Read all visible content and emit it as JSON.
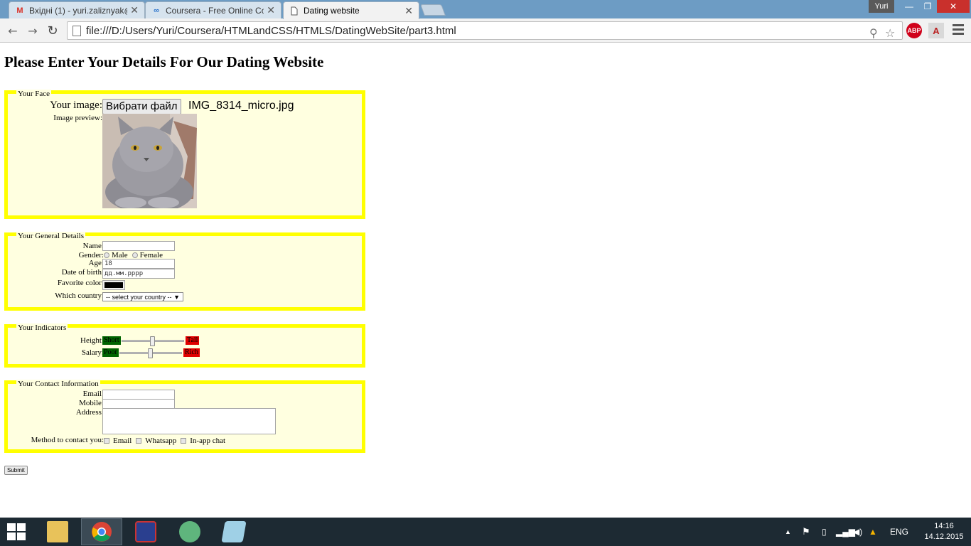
{
  "browser": {
    "tabs": [
      {
        "title": "Вхідні (1) - yuri.zaliznyak@",
        "icon": "gmail-icon"
      },
      {
        "title": "Coursera - Free Online Cou",
        "icon": "coursera-icon"
      },
      {
        "title": "Dating website",
        "icon": "page-icon"
      }
    ],
    "user": "Yuri",
    "url": "file:///D:/Users/Yuri/Coursera/HTMLandCSS/HTMLS/DatingWebSite/part3.html",
    "extensions": [
      "ABP",
      "A"
    ]
  },
  "page": {
    "title": "Please Enter Your Details For Our Dating Website",
    "face": {
      "legend": "Your Face",
      "image_label": "Your image:",
      "file_button": "Вибрати файл",
      "file_name": "IMG_8314_micro.jpg",
      "preview_label": "Image preview:"
    },
    "general": {
      "legend": "Your General Details",
      "name_label": "Name:",
      "gender_label": "Gender:",
      "male": "Male",
      "female": "Female",
      "age_label": "Age:",
      "age_value": "18",
      "dob_label": "Date of birth:",
      "dob_placeholder": "дд.мм.рррр",
      "color_label": "Favorite color:",
      "color_value": "#000000",
      "country_label": "Which country:",
      "country_selected": "-- select your country --"
    },
    "indicators": {
      "legend": "Your Indicators",
      "height_label": "Height:",
      "height_low": "Short",
      "height_high": "Tall",
      "height_level": 0.5,
      "salary_label": "Salary:",
      "salary_low": "Poor",
      "salary_high": "Rich",
      "salary_level": 0.5
    },
    "contact": {
      "legend": "Your Contact Information",
      "email_label": "Email:",
      "mobile_label": "Mobile:",
      "address_label": "Address:",
      "method_label": "Method to contact you:",
      "methods": [
        "Email",
        "Whatsapp",
        "In-app chat"
      ]
    },
    "submit": "Submit"
  },
  "taskbar": {
    "language": "ENG",
    "time": "14:16",
    "date": "14.12.2015"
  },
  "colors": {
    "fieldset_border": "#ffff00",
    "fieldset_bg": "#ffffe0",
    "tag_green": "#006400",
    "tag_red": "#e00000"
  }
}
